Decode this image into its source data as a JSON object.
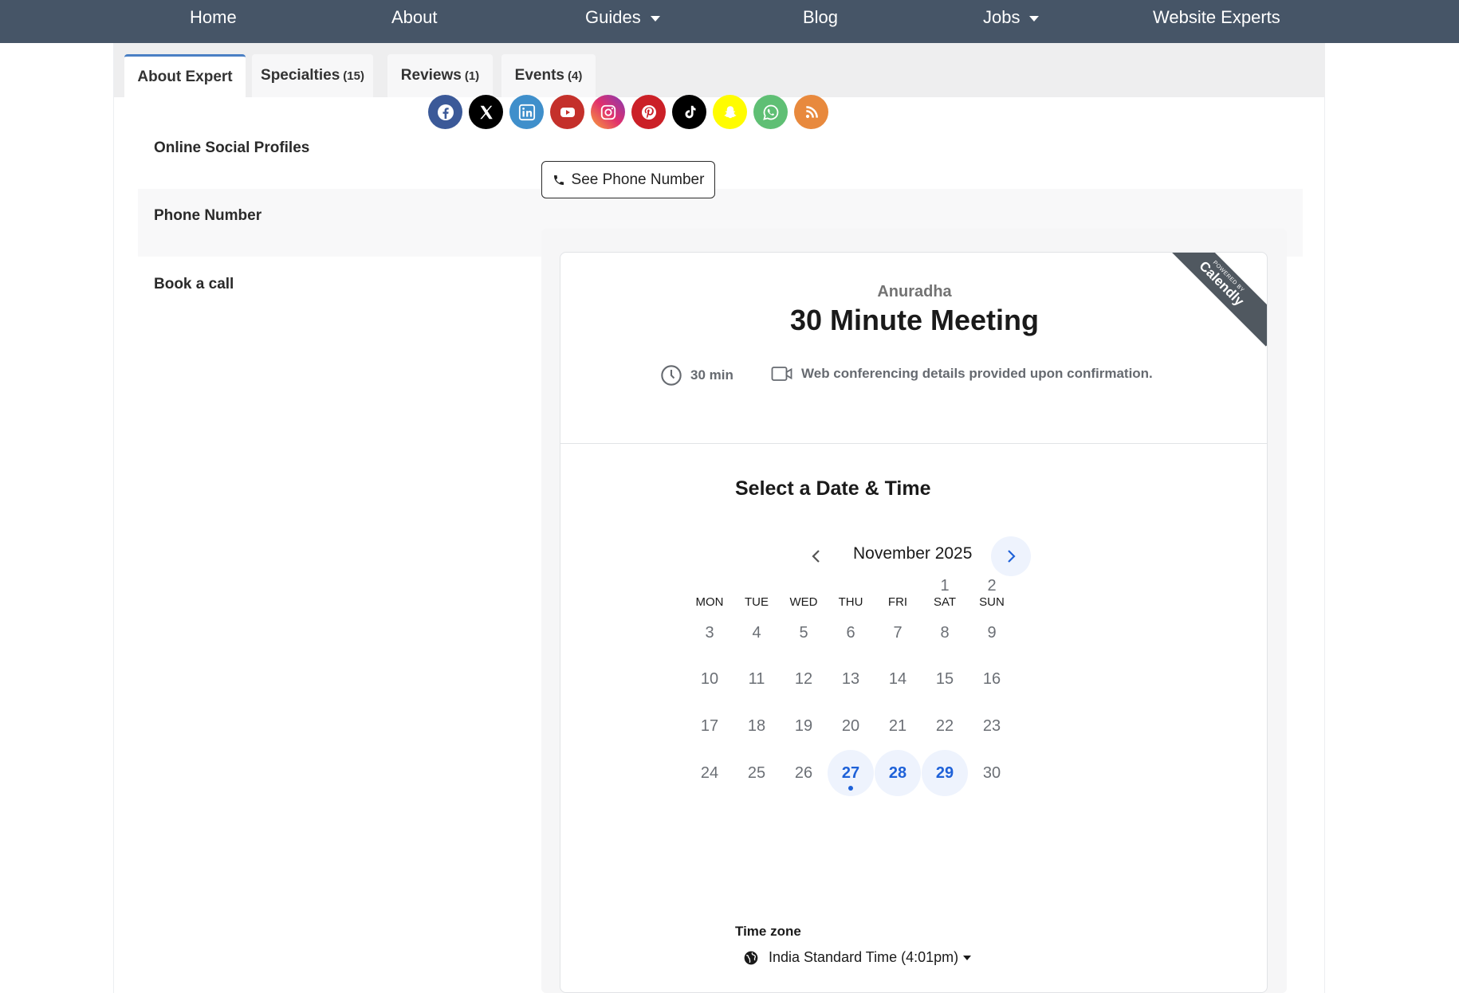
{
  "nav": {
    "items": [
      {
        "label": "Home"
      },
      {
        "label": "About"
      },
      {
        "label": "Guides"
      },
      {
        "label": "Blog"
      },
      {
        "label": "Jobs"
      },
      {
        "label": "Website Experts"
      }
    ]
  },
  "tabs": [
    {
      "label": "About Expert",
      "count": ""
    },
    {
      "label": "Specialties",
      "count": "(15)"
    },
    {
      "label": "Reviews",
      "count": "(1)"
    },
    {
      "label": "Events",
      "count": "(4)"
    }
  ],
  "profile": {
    "social_label": "Online Social Profiles",
    "social_icons": [
      "facebook-icon",
      "x-icon",
      "linkedin-icon",
      "youtube-icon",
      "instagram-icon",
      "pinterest-icon",
      "tiktok-icon",
      "snapchat-icon",
      "whatsapp-icon",
      "rss-icon"
    ],
    "phone_label": "Phone Number",
    "phone_button": "See Phone Number",
    "book_label": "Book a call"
  },
  "calendly": {
    "host": "Anuradha",
    "event_title": "30 Minute Meeting",
    "duration": "30 min",
    "conferencing": "Web conferencing details provided upon confirmation.",
    "ribbon_small": "POWERED BY",
    "ribbon_brand": "Calendly",
    "select_title": "Select a Date & Time",
    "month": "November 2025",
    "weekdays": [
      "MON",
      "TUE",
      "WED",
      "THU",
      "FRI",
      "SAT",
      "SUN"
    ],
    "first_weekday_index": 5,
    "days_in_month": 30,
    "available_days": [
      27,
      28,
      29
    ],
    "today": 27,
    "timezone_label": "Time zone",
    "timezone_value": "India Standard Time (4:01pm)"
  },
  "colors": {
    "nav_bg": "#465567",
    "accent": "#1e61d8",
    "tab_active_border": "#4a7fc4"
  }
}
